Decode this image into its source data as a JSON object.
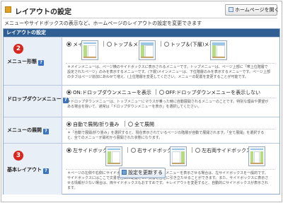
{
  "header": {
    "title": "レイアウトの設定",
    "homepage_button": "ホームページを開く"
  },
  "description": "メニューやサイドボックスの表示など、ホームページのレイアウトの設定を変更できます",
  "panel": {
    "title": "レイアウトの設定",
    "sections": {
      "menu_type": {
        "label": "メニュー形態",
        "badge": "2",
        "options": [
          "メイン",
          "トップ＆メイン",
          "トップ＆(下層)メイン"
        ],
        "selected_index": 0,
        "note": "＊メインメニューは、ページ横のサイドボックスに表示されるメニューです。トップメニューは、ページ上部に「帯上位階層で設定されたページ」のみを表示するメニューです。(下層)メインメニューは、下位階層のみを表示するメニューです。ページ上部のタブはページ追加にあわせて増え、(上位階層を変更してください。メニューの配置を変更することが可能です。"
      },
      "dropdown": {
        "label": "ドロップダウンメニュー",
        "options": [
          "ON:ドロップダウンメニューを表示",
          "OFF:ドロップダウンメニューを表示しない"
        ],
        "selected_index": 0,
        "note": "＊ドロップダウンメニューは、トップメニューにマウスが乗った時に自動展開されるメニューのことです。特別な理由や要望がある場合を除いて、通常は「ドロップダウンメニューを表示」を選択してください。"
      },
      "menu_expand": {
        "label": "メニューの展開",
        "options": [
          "自動で展開/折り畳み",
          "全て展開"
        ],
        "selected_index": 0,
        "note": "＊「自動で展開/折り畳み」を選択すると、現在表示されているページの階層が自動で展開されます。「全て展開」を選択すると、全てのメニューが最初から展開された状態になります。"
      },
      "basic_layout": {
        "label": "基本レイアウト",
        "badge": "3",
        "options": [
          "左サイドボックス",
          "右サイドボックス",
          "左右両サイドボックス"
        ],
        "selected_index": 0,
        "note": "＊ページの左側や右側にサイドボックスを表示します。左側にメニューを表示させる場合は、左サイドボックスを一般的です。サイドボックスにはここで文書を自由に配置させ、文書を自在に引き立たせることができます。また、サイドボックスに表示させる情報が少ない場合は、両サイドボックスもおすすめです。＊レイアウトを変更すると、自動的にサイドボックスが表示されます。"
      }
    },
    "update_button": "設定を更新する"
  },
  "colors": {
    "panel_header": "#2f5e93",
    "label_bg": "#e9eff6",
    "badge": "#d7261e",
    "help_icon": "#3c73c0"
  }
}
